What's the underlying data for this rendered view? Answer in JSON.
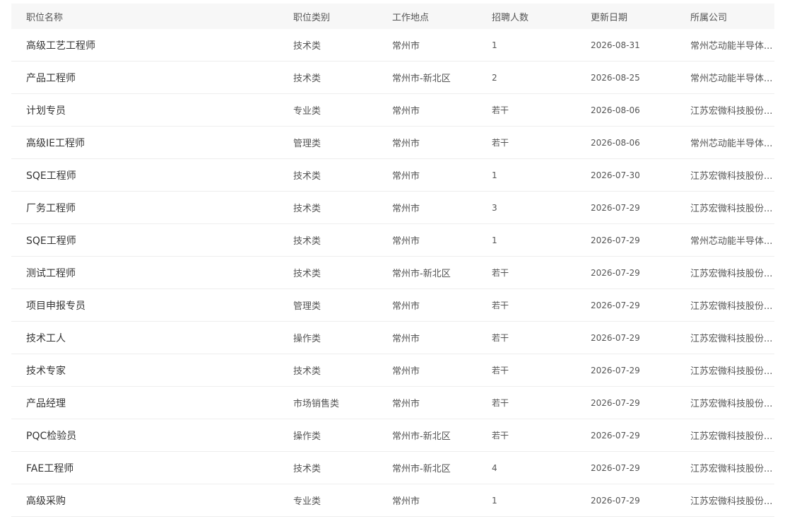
{
  "table": {
    "headers": [
      "职位名称",
      "职位类别",
      "工作地点",
      "招聘人数",
      "更新日期",
      "所属公司"
    ],
    "rows": [
      [
        "高级工艺工程师",
        "技术类",
        "常州市",
        "1",
        "2026-08-31",
        "常州芯动能半导体..."
      ],
      [
        "产品工程师",
        "技术类",
        "常州市-新北区",
        "2",
        "2026-08-25",
        "常州芯动能半导体..."
      ],
      [
        "计划专员",
        "专业类",
        "常州市",
        "若干",
        "2026-08-06",
        "江苏宏微科技股份..."
      ],
      [
        "高级IE工程师",
        "管理类",
        "常州市",
        "若干",
        "2026-08-06",
        "常州芯动能半导体..."
      ],
      [
        "SQE工程师",
        "技术类",
        "常州市",
        "1",
        "2026-07-30",
        "江苏宏微科技股份..."
      ],
      [
        "厂务工程师",
        "技术类",
        "常州市",
        "3",
        "2026-07-29",
        "江苏宏微科技股份..."
      ],
      [
        "SQE工程师",
        "技术类",
        "常州市",
        "1",
        "2026-07-29",
        "常州芯动能半导体..."
      ],
      [
        "测试工程师",
        "技术类",
        "常州市-新北区",
        "若干",
        "2026-07-29",
        "江苏宏微科技股份..."
      ],
      [
        "项目申报专员",
        "管理类",
        "常州市",
        "若干",
        "2026-07-29",
        "江苏宏微科技股份..."
      ],
      [
        "技术工人",
        "操作类",
        "常州市",
        "若干",
        "2026-07-29",
        "江苏宏微科技股份..."
      ],
      [
        "技术专家",
        "技术类",
        "常州市",
        "若干",
        "2026-07-29",
        "江苏宏微科技股份..."
      ],
      [
        "产品经理",
        "市场销售类",
        "常州市",
        "若干",
        "2026-07-29",
        "江苏宏微科技股份..."
      ],
      [
        "PQC检验员",
        "操作类",
        "常州市-新北区",
        "若干",
        "2026-07-29",
        "江苏宏微科技股份..."
      ],
      [
        "FAE工程师",
        "技术类",
        "常州市-新北区",
        "4",
        "2026-07-29",
        "江苏宏微科技股份..."
      ],
      [
        "高级采购",
        "专业类",
        "常州市",
        "1",
        "2026-07-29",
        "江苏宏微科技股份..."
      ]
    ]
  }
}
